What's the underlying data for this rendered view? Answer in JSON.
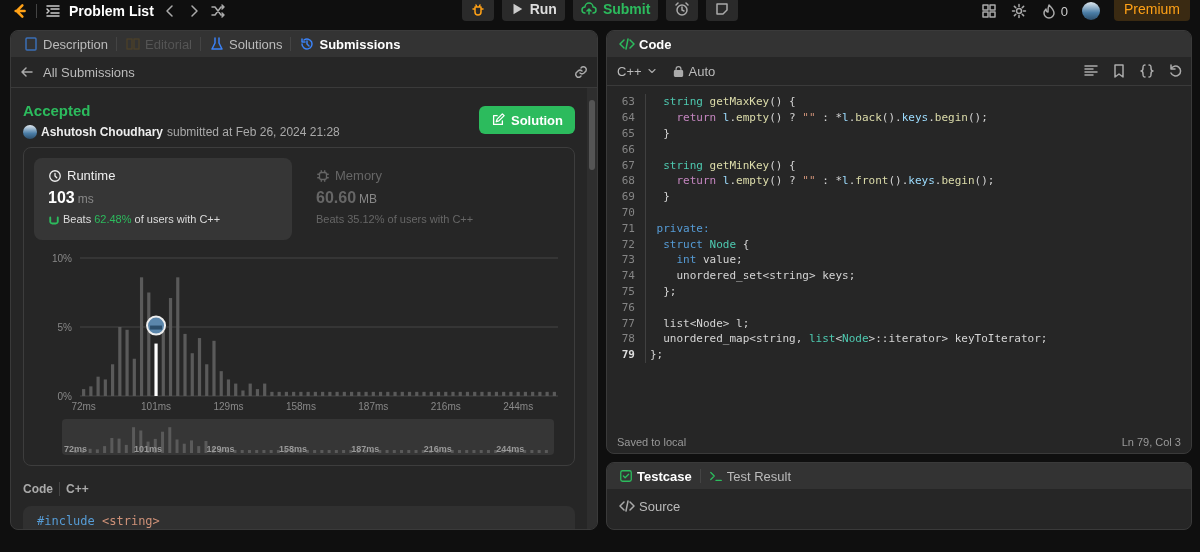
{
  "topbar": {
    "title": "Problem List",
    "run": "Run",
    "submit": "Submit",
    "streak": "0",
    "premium": "Premium"
  },
  "left_panel": {
    "tabs": [
      {
        "label": "Description",
        "selected": false,
        "disabled": false
      },
      {
        "label": "Editorial",
        "selected": false,
        "disabled": true
      },
      {
        "label": "Solutions",
        "selected": false,
        "disabled": false
      },
      {
        "label": "Submissions",
        "selected": true,
        "disabled": false
      }
    ],
    "back_link": "All Submissions",
    "status": "Accepted",
    "author": "Ashutosh Choudhary",
    "submitted": "submitted at Feb 26, 2024 21:28",
    "solution_button": "Solution",
    "stats": [
      {
        "title": "Runtime",
        "value": "103",
        "unit": "ms",
        "beats_label": "Beats",
        "percent": "62.48%",
        "suffix": "of users with C++",
        "selected": true
      },
      {
        "title": "Memory",
        "value": "60.60",
        "unit": "MB",
        "beats_label": "Beats",
        "percent": "35.12%",
        "suffix": "of users with C++",
        "selected": false
      }
    ],
    "chart_data": {
      "type": "bar",
      "categories": [
        "72ms",
        null,
        null,
        null,
        null,
        null,
        null,
        null,
        null,
        null,
        "101ms",
        null,
        null,
        null,
        null,
        null,
        null,
        null,
        null,
        null,
        "129ms",
        null,
        null,
        null,
        null,
        null,
        null,
        null,
        null,
        null,
        "158ms",
        null,
        null,
        null,
        null,
        null,
        null,
        null,
        null,
        null,
        "187ms",
        null,
        null,
        null,
        null,
        null,
        null,
        null,
        null,
        null,
        "216ms",
        null,
        null,
        null,
        null,
        null,
        null,
        null,
        null,
        null,
        "244ms",
        null,
        null,
        null,
        null,
        null
      ],
      "values": [
        0.5,
        0.7,
        1.4,
        1.2,
        2.3,
        5.0,
        4.8,
        2.7,
        8.6,
        7.5,
        3.8,
        4.7,
        7.1,
        8.6,
        4.5,
        3.1,
        4.2,
        2.3,
        4.0,
        1.8,
        1.2,
        0.9,
        0.4,
        0.9,
        0.5,
        0.9,
        0.3,
        0.3,
        0.3,
        0.3,
        0.3,
        0.3,
        0.3,
        0.3,
        0.3,
        0.3,
        0.3,
        0.3,
        0.3,
        0.3,
        0.3,
        0.3,
        0.3,
        0.3,
        0.3,
        0.3,
        0.3,
        0.3,
        0.3,
        0.3,
        0.3,
        0.3,
        0.3,
        0.3,
        0.3,
        0.3,
        0.3,
        0.3,
        0.3,
        0.3,
        0.3,
        0.3,
        0.3,
        0.3,
        0.3,
        0.3
      ],
      "ylim": [
        0,
        10
      ],
      "yticks": [
        {
          "value": 0,
          "label": "0%"
        },
        {
          "value": 5,
          "label": "5%"
        },
        {
          "value": 10,
          "label": "10%"
        }
      ],
      "annotations": [
        {
          "x": "101ms"
        }
      ]
    },
    "navigator_labels": [
      "72ms",
      "101ms",
      "129ms",
      "158ms",
      "187ms",
      "216ms",
      "244ms"
    ],
    "code_label": "Code",
    "code_lang": "C++",
    "code_preview": [
      {
        "text": "#include",
        "kind": "blue"
      },
      {
        "text": " <string>",
        "kind": "str"
      }
    ]
  },
  "editor": {
    "title": "Code",
    "language": "C++",
    "mode": "Auto",
    "lines": [
      {
        "n": "63",
        "current": false,
        "tokens": [
          {
            "text": "  string",
            "kind": "type"
          },
          {
            "text": " getMaxKey",
            "kind": "fn"
          },
          {
            "text": "() {",
            "kind": "plain"
          }
        ]
      },
      {
        "n": "64",
        "current": false,
        "tokens": [
          {
            "text": "    return",
            "kind": "kw"
          },
          {
            "text": " l",
            "kind": "var"
          },
          {
            "text": ".",
            "kind": "plain"
          },
          {
            "text": "empty",
            "kind": "fn"
          },
          {
            "text": "() ? ",
            "kind": "plain"
          },
          {
            "text": "\"\"",
            "kind": "str"
          },
          {
            "text": " : *",
            "kind": "plain"
          },
          {
            "text": "l",
            "kind": "var"
          },
          {
            "text": ".",
            "kind": "plain"
          },
          {
            "text": "back",
            "kind": "fn"
          },
          {
            "text": "().",
            "kind": "plain"
          },
          {
            "text": "keys",
            "kind": "var"
          },
          {
            "text": ".",
            "kind": "plain"
          },
          {
            "text": "begin",
            "kind": "fn"
          },
          {
            "text": "();",
            "kind": "plain"
          }
        ]
      },
      {
        "n": "65",
        "current": false,
        "tokens": [
          {
            "text": "  }",
            "kind": "plain"
          }
        ]
      },
      {
        "n": "66",
        "current": false
      },
      {
        "n": "67",
        "current": false,
        "tokens": [
          {
            "text": "  string",
            "kind": "type"
          },
          {
            "text": " getMinKey",
            "kind": "fn"
          },
          {
            "text": "() {",
            "kind": "plain"
          }
        ]
      },
      {
        "n": "68",
        "current": false,
        "tokens": [
          {
            "text": "    return",
            "kind": "kw"
          },
          {
            "text": " l",
            "kind": "var"
          },
          {
            "text": ".",
            "kind": "plain"
          },
          {
            "text": "empty",
            "kind": "fn"
          },
          {
            "text": "() ? ",
            "kind": "plain"
          },
          {
            "text": "\"\"",
            "kind": "str"
          },
          {
            "text": " : *",
            "kind": "plain"
          },
          {
            "text": "l",
            "kind": "var"
          },
          {
            "text": ".",
            "kind": "plain"
          },
          {
            "text": "front",
            "kind": "fn"
          },
          {
            "text": "().",
            "kind": "plain"
          },
          {
            "text": "keys",
            "kind": "var"
          },
          {
            "text": ".",
            "kind": "plain"
          },
          {
            "text": "begin",
            "kind": "fn"
          },
          {
            "text": "();",
            "kind": "plain"
          }
        ]
      },
      {
        "n": "69",
        "current": false,
        "tokens": [
          {
            "text": "  }",
            "kind": "plain"
          }
        ]
      },
      {
        "n": "70",
        "current": false
      },
      {
        "n": "71",
        "current": false,
        "tokens": [
          {
            "text": " private:",
            "kind": "blue"
          }
        ]
      },
      {
        "n": "72",
        "current": false,
        "tokens": [
          {
            "text": "  struct",
            "kind": "blue"
          },
          {
            "text": " Node",
            "kind": "type"
          },
          {
            "text": " {",
            "kind": "plain"
          }
        ]
      },
      {
        "n": "73",
        "current": false,
        "tokens": [
          {
            "text": "    int",
            "kind": "blue"
          },
          {
            "text": " value;",
            "kind": "plain"
          }
        ]
      },
      {
        "n": "74",
        "current": false,
        "tokens": [
          {
            "text": "    unordered_set<string> keys;",
            "kind": "plain"
          }
        ]
      },
      {
        "n": "75",
        "current": false,
        "tokens": [
          {
            "text": "  };",
            "kind": "plain"
          }
        ]
      },
      {
        "n": "76",
        "current": false
      },
      {
        "n": "77",
        "current": false,
        "tokens": [
          {
            "text": "  list<Node> l;",
            "kind": "plain"
          }
        ]
      },
      {
        "n": "78",
        "current": false,
        "tokens": [
          {
            "text": "  unordered_map<string, ",
            "kind": "plain"
          },
          {
            "text": "list",
            "kind": "type"
          },
          {
            "text": "<",
            "kind": "plain"
          },
          {
            "text": "Node",
            "kind": "type"
          },
          {
            "text": ">::iterator> keyToIterator;",
            "kind": "plain"
          }
        ]
      },
      {
        "n": "79",
        "current": true,
        "tokens": [
          {
            "text": "};",
            "kind": "plain"
          }
        ]
      }
    ],
    "saved": "Saved to local",
    "cursor": "Ln 79, Col 3"
  },
  "bottom_panel": {
    "tabs": [
      {
        "label": "Testcase",
        "selected": true
      },
      {
        "label": "Test Result",
        "selected": false
      }
    ],
    "source": "Source"
  }
}
